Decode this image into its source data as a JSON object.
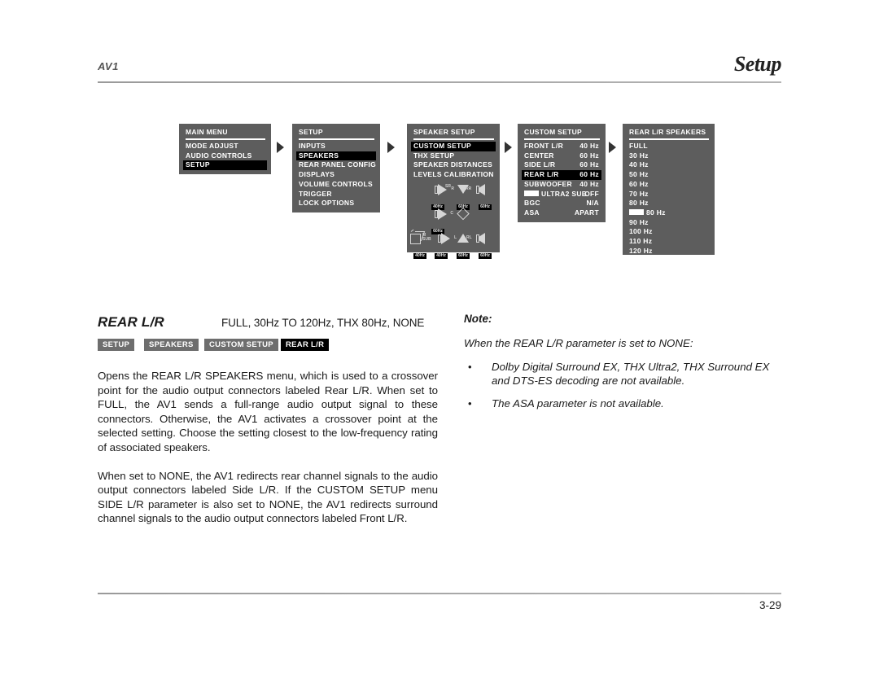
{
  "header": {
    "model": "AV1",
    "section": "Setup"
  },
  "menu_flow": {
    "panels": [
      {
        "title": "MAIN MENU",
        "rows": [
          {
            "label": "MODE ADJUST",
            "selected": false
          },
          {
            "label": "AUDIO CONTROLS",
            "selected": false
          },
          {
            "label": "SETUP",
            "selected": true
          }
        ]
      },
      {
        "title": "SETUP",
        "rows": [
          {
            "label": "INPUTS",
            "selected": false
          },
          {
            "label": "SPEAKERS",
            "selected": true
          },
          {
            "label": "REAR PANEL CONFIG",
            "selected": false
          },
          {
            "label": "DISPLAYS",
            "selected": false
          },
          {
            "label": "VOLUME CONTROLS",
            "selected": false
          },
          {
            "label": "TRIGGER",
            "selected": false
          },
          {
            "label": "LOCK OPTIONS",
            "selected": false
          }
        ]
      },
      {
        "title": "SPEAKER SETUP",
        "rows": [
          {
            "label": "CUSTOM SETUP",
            "selected": true
          },
          {
            "label": "THX SETUP",
            "selected": false
          },
          {
            "label": "SPEAKER DISTANCES",
            "selected": false
          },
          {
            "label": "LEVELS CALIBRATION",
            "selected": false
          }
        ],
        "speaker_layout": [
          {
            "channel": "R",
            "freq": "40Hz",
            "icon": "speaker-cone-left"
          },
          {
            "channel": "SR",
            "freq": "60Hz",
            "icon": "speaker-cone-down"
          },
          {
            "channel": "RR",
            "freq": "60Hz",
            "icon": "speaker-cone-right"
          },
          {
            "channel": "C",
            "freq": "60Hz",
            "icon": "speaker-cone-left"
          },
          {
            "channel": "",
            "freq": "",
            "icon": "listener-diamond"
          },
          {
            "channel": "SUB",
            "freq": "40Hz",
            "icon": "subwoofer-cube"
          },
          {
            "channel": "L",
            "freq": "40Hz",
            "icon": "speaker-cone-left"
          },
          {
            "channel": "SL",
            "freq": "60Hz",
            "icon": "speaker-cone-up"
          },
          {
            "channel": "RL",
            "freq": "60Hz",
            "icon": "speaker-cone-right"
          }
        ],
        "sub_label": "M\nSUB"
      },
      {
        "title": "CUSTOM SETUP",
        "rows": [
          {
            "label": "FRONT L/R",
            "value": "40 Hz",
            "selected": false
          },
          {
            "label": "CENTER",
            "value": "60 Hz",
            "selected": false
          },
          {
            "label": "SIDE L/R",
            "value": "60 Hz",
            "selected": false
          },
          {
            "label": "REAR L/R",
            "value": "60 Hz",
            "selected": true
          },
          {
            "label": "SUBWOOFER",
            "value": "40 Hz",
            "selected": false
          },
          {
            "label": "ULTRA2 SUB",
            "value": "OFF",
            "selected": false,
            "swatch": true
          },
          {
            "label": "BGC",
            "value": "N/A",
            "selected": false
          },
          {
            "label": "ASA",
            "value": "APART",
            "selected": false
          }
        ]
      },
      {
        "title": "REAR L/R SPEAKERS",
        "rows": [
          {
            "label": "FULL",
            "selected": false
          },
          {
            "label": "30 Hz",
            "selected": false
          },
          {
            "label": "40 Hz",
            "selected": false
          },
          {
            "label": "50 Hz",
            "selected": false
          },
          {
            "label": "60 Hz",
            "selected": false
          },
          {
            "label": "70 Hz",
            "selected": false
          },
          {
            "label": "80 Hz",
            "selected": false
          },
          {
            "label": "80 Hz",
            "selected": false,
            "swatch": true
          },
          {
            "label": "90 Hz",
            "selected": false
          },
          {
            "label": "100 Hz",
            "selected": false
          },
          {
            "label": "110 Hz",
            "selected": false
          },
          {
            "label": "120 Hz",
            "selected": false
          }
        ]
      }
    ]
  },
  "parameter": {
    "name": "REAR L/R",
    "values": "FULL, 30Hz TO 120Hz, THX 80Hz, NONE",
    "breadcrumb": [
      {
        "label": "SETUP",
        "active": false
      },
      {
        "label": "SPEAKERS",
        "active": false
      },
      {
        "label": "CUSTOM SETUP",
        "active": false
      },
      {
        "label": "REAR L/R",
        "active": true
      }
    ],
    "paragraphs": [
      "Opens the REAR L/R SPEAKERS menu, which is used to a crossover point for the audio output connectors labeled Rear L/R. When set to FULL, the AV1 sends a full-range audio output signal to these connectors. Otherwise, the AV1 activates a crossover point at the selected setting. Choose the setting closest to the low-frequency rating of associated speakers.",
      "When set to NONE, the AV1 redirects rear channel signals to the audio output connectors labeled Side L/R. If the CUSTOM SETUP menu SIDE L/R parameter is also set to NONE, the AV1 redirects surround channel signals to the audio output connectors labeled Front L/R."
    ]
  },
  "note": {
    "label": "Note:",
    "intro": "When the REAR L/R parameter is set to NONE:",
    "bullet_glyph": "•",
    "items": [
      "Dolby Digital Surround EX, THX Ultra2, THX Surround EX and DTS-ES decoding are not available.",
      "The ASA parameter is not available."
    ]
  },
  "footer": {
    "page_number": "3-29"
  },
  "colors": {
    "osd_background": "#5d5d5d",
    "osd_selected": "#000000",
    "osd_text": "#ffffff",
    "crumb_background": "#6e6e6e",
    "crumb_active": "#000000",
    "rule": "#9a9a9a"
  }
}
